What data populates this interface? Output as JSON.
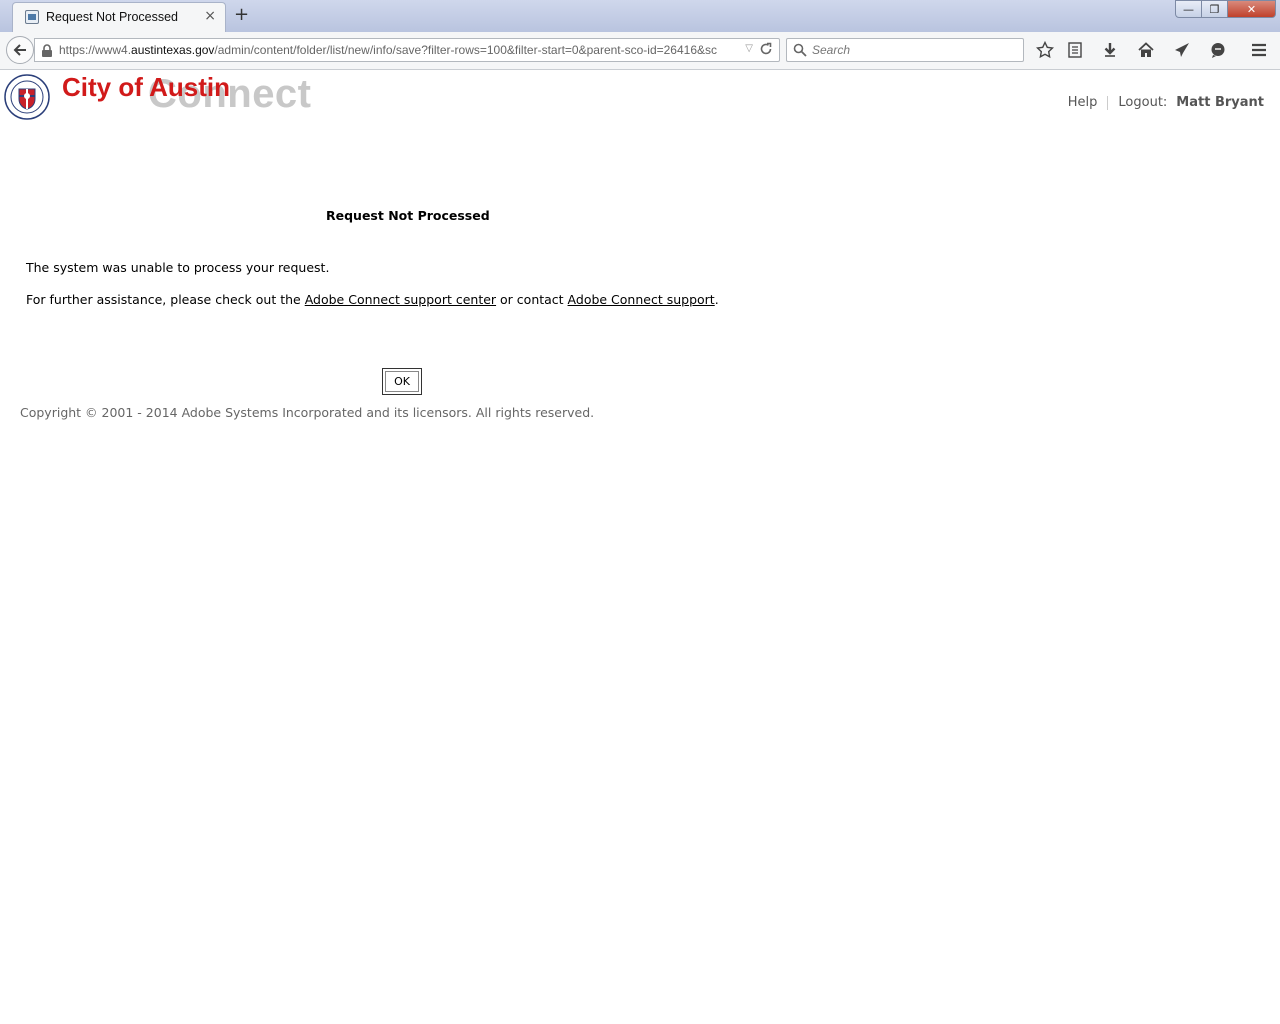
{
  "browser": {
    "tab_title": "Request Not Processed",
    "tab_close": "×",
    "new_tab": "+",
    "url_prefix": "https://www4.",
    "url_domain": "austintexas.gov",
    "url_path": "/admin/content/folder/list/new/info/save?filter-rows=100&filter-start=0&parent-sco-id=26416&sc",
    "search_placeholder": "Search",
    "toolbar_icons": [
      "star-icon",
      "reading-list-icon",
      "download-icon",
      "home-icon",
      "send-icon",
      "chat-icon",
      "menu-icon"
    ],
    "window_buttons": {
      "minimize": "—",
      "maximize": "❐",
      "close": "✕"
    }
  },
  "header": {
    "logo_city": "City of Austin",
    "logo_connect": "Connect",
    "help": "Help",
    "logout_label": "Logout:",
    "user_name": "Matt Bryant"
  },
  "main": {
    "title": "Request Not Processed",
    "message": "The system was unable to process your request.",
    "assist_prefix": "For further assistance, please check out the ",
    "support_center_link": "Adobe Connect support center",
    "assist_middle": " or contact ",
    "support_link": "Adobe Connect support",
    "assist_suffix": ".",
    "ok_button": "OK"
  },
  "footer": {
    "copyright": "Copyright © 2001 - 2014 Adobe Systems Incorporated and its licensors. All rights reserved."
  },
  "colors": {
    "city_red": "#d11a1a",
    "connect_gray": "#c8c8c8"
  }
}
